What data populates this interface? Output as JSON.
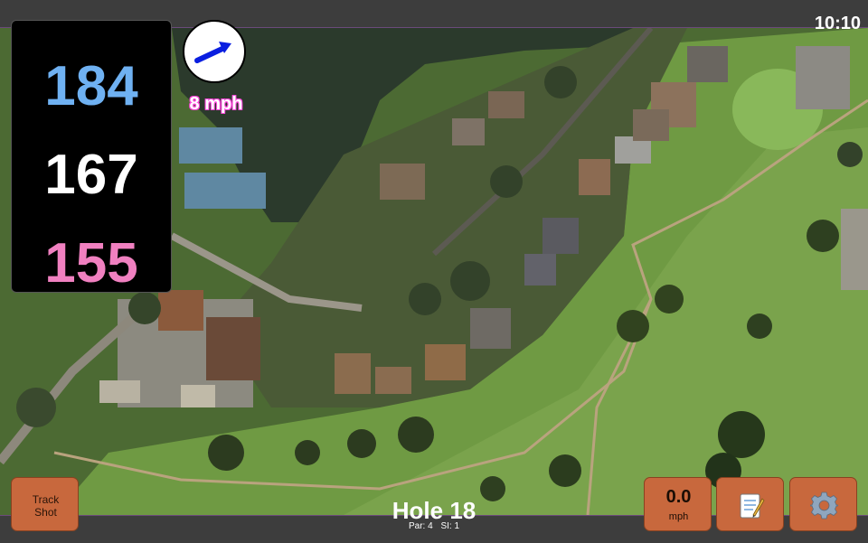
{
  "status_bar": {
    "time": "10:10"
  },
  "distances": {
    "back": {
      "value": "184",
      "color": "#6fb1f2"
    },
    "middle": {
      "value": "167",
      "color": "#ffffff"
    },
    "front": {
      "value": "155",
      "color": "#f080c0"
    }
  },
  "wind": {
    "speed": "8 mph",
    "label_color": "#ff44dd",
    "arrow_color": "#0a1ee0",
    "direction_icon": "arrow-northeast-icon"
  },
  "buttons": {
    "track_shot": "Track\nShot",
    "speed_value": "0.0",
    "speed_unit": "mph",
    "notes_icon": "notepad-icon",
    "settings_icon": "gear-icon",
    "button_color": "#c8683d"
  },
  "hole": {
    "title": "Hole 18",
    "par": "Par: 4",
    "si": "SI: 1"
  }
}
